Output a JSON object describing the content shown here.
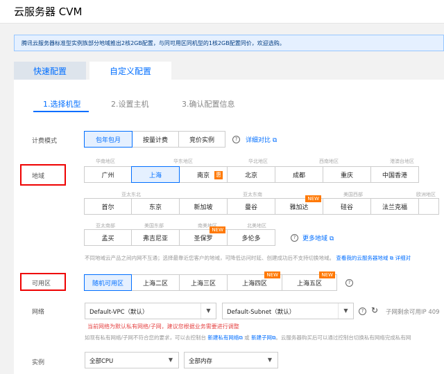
{
  "header": {
    "title": "云服务器 CVM"
  },
  "notice": "腾讯云服务器标准型实例族部分地域推出2核2GB配置，与同可用区同机型的1核2GB配置同价，欢迎选购。",
  "tabs": {
    "quick": "快速配置",
    "custom": "自定义配置"
  },
  "steps": [
    "1.选择机型",
    "2.设置主机",
    "3.确认配置信息"
  ],
  "billing": {
    "label": "计费模式",
    "options": [
      "包年包月",
      "按量计费",
      "竞价实例"
    ],
    "selected": "包年包月",
    "compare_link": "详细对比"
  },
  "region": {
    "label": "地域",
    "groups_row1": [
      "华南地区",
      "华东地区",
      "华北地区",
      "西南地区",
      "港澳台地区"
    ],
    "row1": [
      "广州",
      "上海",
      "南京",
      "北京",
      "成都",
      "重庆",
      "中国香港"
    ],
    "hot_badge": "惠",
    "groups_row2": [
      "亚太东北",
      "亚太东南",
      "美国西部",
      "欧洲地区"
    ],
    "row2": [
      "首尔",
      "东京",
      "新加坡",
      "曼谷",
      "雅加达",
      "硅谷",
      "法兰克福"
    ],
    "groups_row3": [
      "亚太南部",
      "美国东部",
      "南美地区",
      "北美地区"
    ],
    "row3": [
      "孟买",
      "弗吉尼亚",
      "圣保罗",
      "多伦多"
    ],
    "new_badge": "NEW",
    "more_link": "更多地域",
    "selected": "上海",
    "hint": "不同地域云产品之间内网不互通；选择最靠近您客户的地域，可降低访问时延、创建成功后不支持切换地域。",
    "hint_link1": "查看我的云服务器地域",
    "hint_link2": "详细对"
  },
  "zone": {
    "label": "可用区",
    "options": [
      "随机可用区",
      "上海二区",
      "上海三区",
      "上海四区",
      "上海五区"
    ],
    "selected": "随机可用区"
  },
  "network": {
    "label": "网络",
    "vpc": "Default-VPC（默认）",
    "subnet": "Default-Subnet（默认）",
    "ip_text": "子网剩余可用IP 409",
    "warning": "当前网络为默认私有网络/子网，建议您根据业务需要进行调整",
    "hint_a": "如现有私有网络/子网不符合您的要求，可以去控制台",
    "hint_link1": "新建私有网络",
    "hint_or": "或",
    "hint_link2": "新建子网",
    "hint_b": "。云服务器购买后可以通过控制台切换私有网络完成私有网"
  },
  "instance": {
    "label": "实例",
    "cpu": "全部CPU",
    "mem": "全部内存"
  },
  "colors": {
    "accent": "#006eff",
    "badge": "#ff7800",
    "annotation": "#ee0000"
  },
  "icons": [
    "help-icon",
    "external-link-icon",
    "chevron-down-icon",
    "refresh-icon"
  ]
}
